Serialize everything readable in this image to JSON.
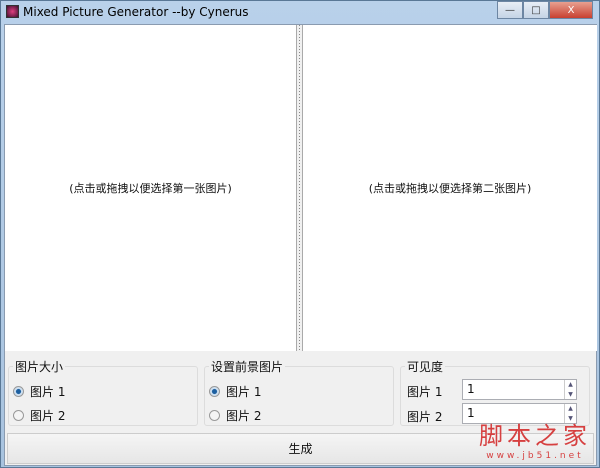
{
  "window": {
    "title": "Mixed Picture Generator    --by Cynerus",
    "min": "—",
    "max": "□",
    "close": "X"
  },
  "panels": {
    "left_hint": "(点击或拖拽以便选择第一张图片)",
    "right_hint": "(点击或拖拽以便选择第二张图片)"
  },
  "size_group": {
    "label": "图片大小",
    "options": [
      "图片 1",
      "图片 2"
    ],
    "selected": 0
  },
  "foreground_group": {
    "label": "设置前景图片",
    "options": [
      "图片 1",
      "图片 2"
    ],
    "selected": 0
  },
  "visibility_group": {
    "label": "可见度",
    "rows": [
      {
        "label": "图片 1",
        "value": "1"
      },
      {
        "label": "图片 2",
        "value": "1"
      }
    ]
  },
  "generate_label": "生成",
  "watermark": {
    "main": "脚本之家",
    "url": "www.jb51.net"
  }
}
